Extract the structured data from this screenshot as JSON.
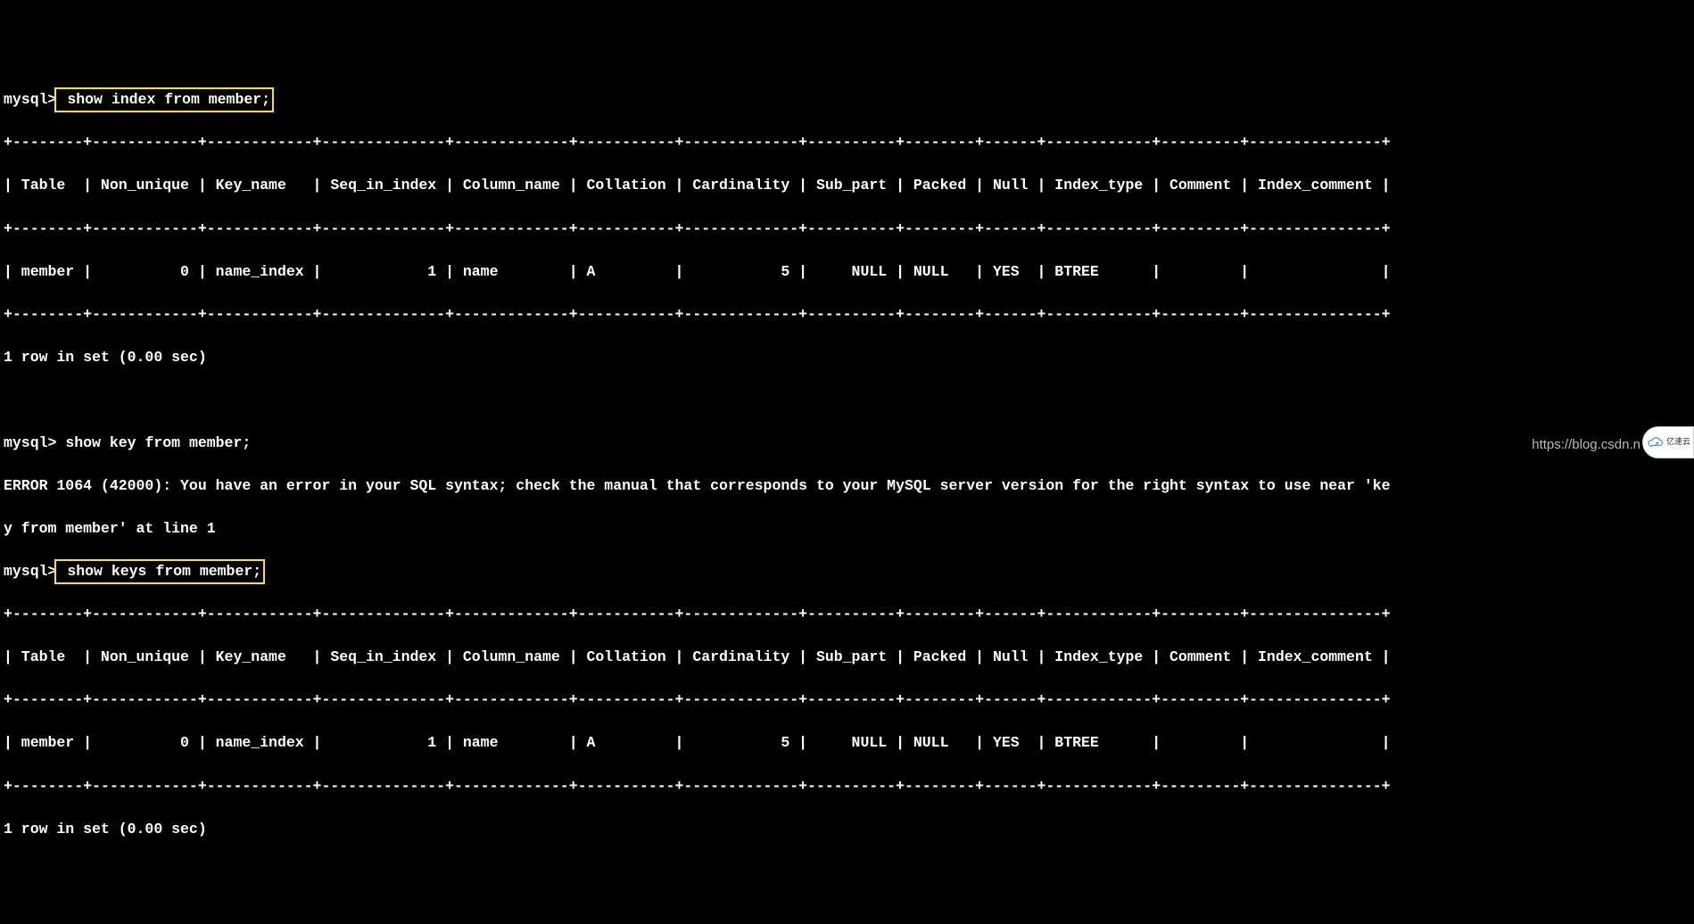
{
  "prompt": "mysql>",
  "commands": {
    "first": " show index from member;",
    "second": " show key from member;",
    "third": " show keys from member;"
  },
  "table": {
    "border_top": "+--------+------------+------------+--------------+-------------+-----------+-------------+----------+--------+------+------------+---------+---------------+",
    "header": "| Table  | Non_unique | Key_name   | Seq_in_index | Column_name | Collation | Cardinality | Sub_part | Packed | Null | Index_type | Comment | Index_comment |",
    "border_mid": "+--------+------------+------------+--------------+-------------+-----------+-------------+----------+--------+------+------------+---------+---------------+",
    "row": "| member |          0 | name_index |            1 | name        | A         |           5 |     NULL | NULL   | YES  | BTREE      |         |               |",
    "border_bottom": "+--------+------------+------------+--------------+-------------+-----------+-------------+----------+--------+------+------------+---------+---------------+",
    "result": "1 row in set (0.00 sec)"
  },
  "error_line1": "ERROR 1064 (42000): You have an error in your SQL syntax; check the manual that corresponds to your MySQL server version for the right syntax to use near 'ke",
  "error_line2": "y from member' at line 1",
  "watermark": "https://blog.csdn.n",
  "badge_text": "亿速云",
  "chart_data": {
    "type": "table",
    "columns": [
      "Table",
      "Non_unique",
      "Key_name",
      "Seq_in_index",
      "Column_name",
      "Collation",
      "Cardinality",
      "Sub_part",
      "Packed",
      "Null",
      "Index_type",
      "Comment",
      "Index_comment"
    ],
    "rows": [
      [
        "member",
        0,
        "name_index",
        1,
        "name",
        "A",
        5,
        "NULL",
        "NULL",
        "YES",
        "BTREE",
        "",
        ""
      ]
    ]
  }
}
